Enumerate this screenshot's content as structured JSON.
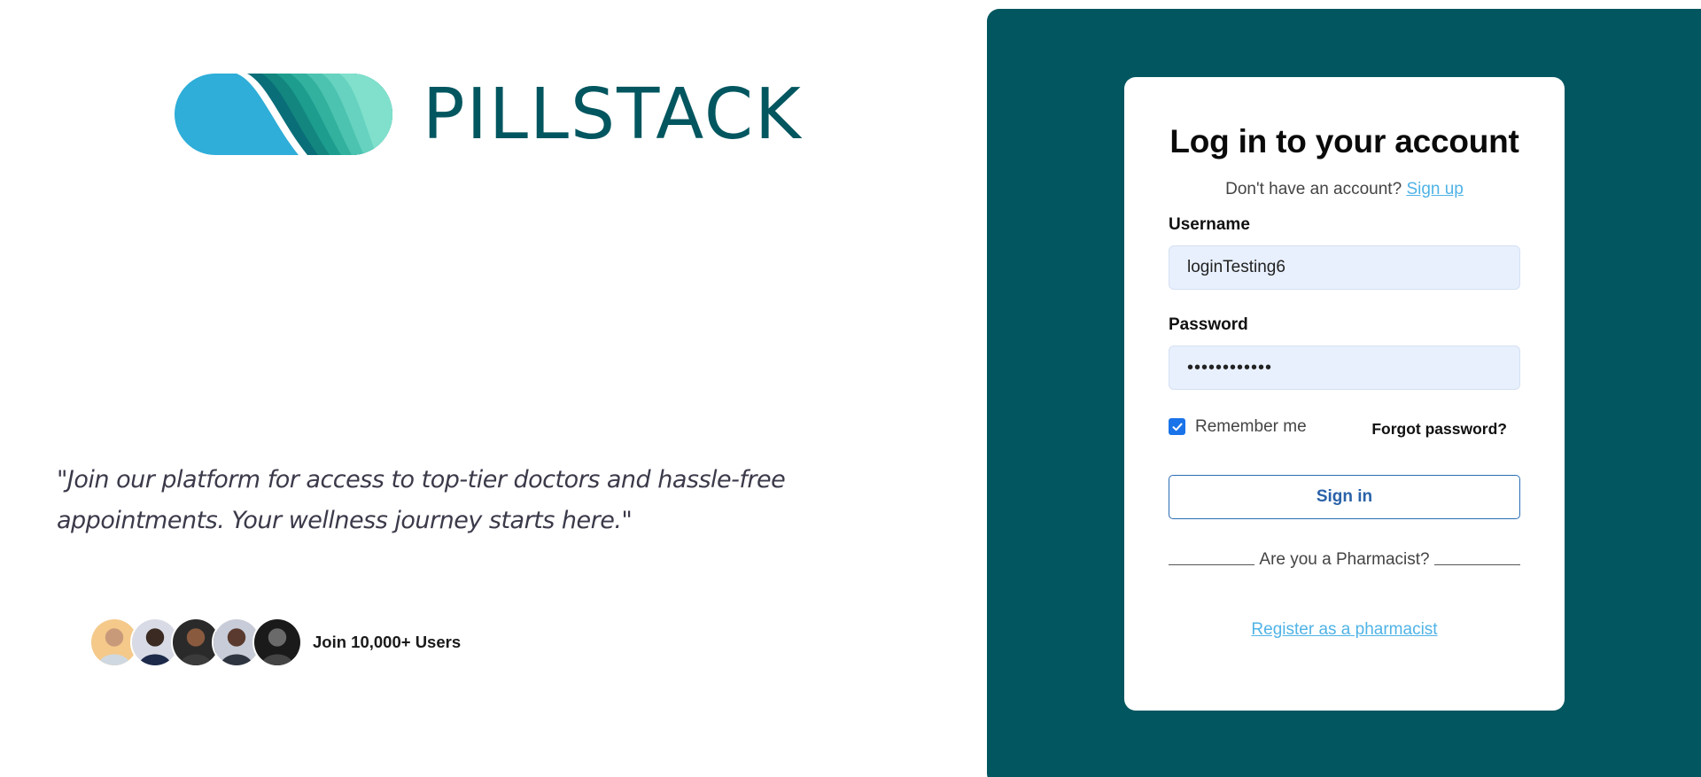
{
  "brand": {
    "name": "PILLSTACK",
    "logo_icon": "pill-stack-logo-icon",
    "colors": {
      "primary": "#02565f",
      "pill_blue": "#2eaed8"
    }
  },
  "hero": {
    "quote": "\"Join our platform for access to top-tier doctors and hassle-free appointments. Your wellness journey starts here.\""
  },
  "community": {
    "label": "Join 10,000+ Users",
    "avatar_count": 5
  },
  "login": {
    "title": "Log in to your account",
    "signup_prompt": "Don't have an account?",
    "signup_link": "Sign up",
    "username_label": "Username",
    "username_value": "loginTesting6",
    "password_label": "Password",
    "password_value": "loginTesting",
    "remember_label": "Remember me",
    "remember_checked": true,
    "forgot_label": "Forgot password?",
    "signin_label": "Sign in",
    "pharmacist_prompt": "Are you a Pharmacist?",
    "register_link": "Register as a pharmacist"
  },
  "colors": {
    "panel_bg": "#02565f",
    "input_bg": "#e8f0fe",
    "link": "#4fb3e6",
    "button_border": "#2a6db5",
    "checkbox": "#1a73e8"
  }
}
